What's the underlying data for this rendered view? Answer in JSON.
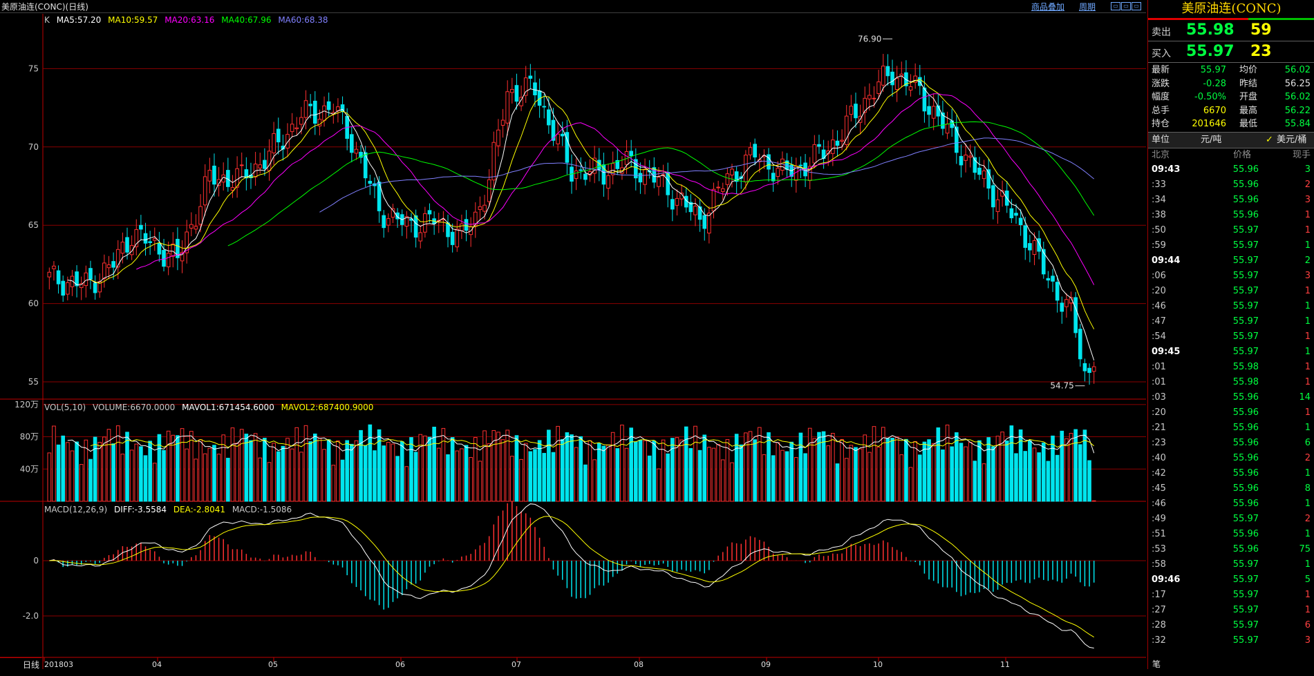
{
  "header": {
    "title": "美原油连(CONC)(日线)",
    "links": [
      "商品叠加",
      "周期"
    ]
  },
  "price_panel": {
    "legend_prefix": "K",
    "ma": [
      {
        "label": "MA5:57.20",
        "color": "#ffffff"
      },
      {
        "label": "MA10:59.57",
        "color": "#ffff00"
      },
      {
        "label": "MA20:63.16",
        "color": "#ff00ff"
      },
      {
        "label": "MA40:67.96",
        "color": "#00ff00"
      },
      {
        "label": "MA60:68.38",
        "color": "#8080ff"
      }
    ],
    "y_ticks": [
      "75",
      "70",
      "65",
      "60",
      "55"
    ],
    "y_values": [
      75,
      70,
      65,
      60,
      55
    ],
    "y_range": [
      53.9,
      78.5
    ],
    "high_label": "76.90",
    "high_value": 76.9,
    "low_label": "54.75",
    "low_value": 54.75
  },
  "volume_panel": {
    "legend": [
      {
        "label": "VOL(5,10)",
        "color": "#c8c8c8"
      },
      {
        "label": "VOLUME:6670.0000",
        "color": "#c8c8c8"
      },
      {
        "label": "MAVOL1:671454.6000",
        "color": "#ffffff"
      },
      {
        "label": "MAVOL2:687400.9000",
        "color": "#ffff00"
      }
    ],
    "y_ticks": [
      "120万",
      "80万",
      "40万"
    ],
    "y_values": [
      120,
      80,
      40
    ],
    "y_range": [
      0,
      125
    ]
  },
  "macd_panel": {
    "legend": [
      {
        "label": "MACD(12,26,9)",
        "color": "#c8c8c8"
      },
      {
        "label": "DIFF:-3.5584",
        "color": "#ffffff"
      },
      {
        "label": "DEA:-2.8041",
        "color": "#ffff00"
      },
      {
        "label": "MACD:-1.5086",
        "color": "#c8c8c8"
      }
    ],
    "y_ticks": [
      "0",
      "-2.0"
    ],
    "y_values": [
      0,
      -2
    ],
    "y_range": [
      -3.5,
      2.1
    ]
  },
  "x_axis": {
    "period_label": "日线",
    "labels": [
      "201803",
      "04",
      "05",
      "06",
      "07",
      "08",
      "09",
      "10",
      "11"
    ]
  },
  "quote": {
    "title": "美原油连(CONC)",
    "ask_label": "卖出",
    "ask_price": "55.98",
    "ask_vol": "59",
    "bid_label": "买入",
    "bid_price": "55.97",
    "bid_vol": "23",
    "stats": [
      {
        "label": "最新",
        "value": "55.97",
        "color": "#00ff40"
      },
      {
        "label": "均价",
        "value": "56.02",
        "color": "#00ff40"
      },
      {
        "label": "涨跌",
        "value": "-0.28",
        "color": "#00ff40"
      },
      {
        "label": "昨结",
        "value": "56.25",
        "color": "#e0e0e0"
      },
      {
        "label": "幅度",
        "value": "-0.50%",
        "color": "#00ff40"
      },
      {
        "label": "开盘",
        "value": "56.02",
        "color": "#00ff40"
      },
      {
        "label": "总手",
        "value": "6670",
        "color": "#ffff00"
      },
      {
        "label": "最高",
        "value": "56.22",
        "color": "#00ff40"
      },
      {
        "label": "持仓",
        "value": "201646",
        "color": "#ffff00"
      },
      {
        "label": "最低",
        "value": "55.84",
        "color": "#00ff40"
      }
    ],
    "unit_label": "单位",
    "unit_value": "元/吨",
    "unit_alt": "美元/桶",
    "col_time": "北京",
    "col_price": "价格",
    "col_vol": "现手",
    "bottom_label": "笔"
  },
  "ticks": [
    {
      "t": "09:43",
      "p": "55.96",
      "v": "3",
      "c": "#00ff40",
      "b": true
    },
    {
      "t": ":33",
      "p": "55.96",
      "v": "2",
      "c": "#ff4040",
      "b": false
    },
    {
      "t": ":34",
      "p": "55.96",
      "v": "3",
      "c": "#ff4040",
      "b": false
    },
    {
      "t": ":38",
      "p": "55.96",
      "v": "1",
      "c": "#ff4040",
      "b": false
    },
    {
      "t": ":50",
      "p": "55.97",
      "v": "1",
      "c": "#ff4040",
      "b": false
    },
    {
      "t": ":59",
      "p": "55.97",
      "v": "1",
      "c": "#00ff40",
      "b": false
    },
    {
      "t": "09:44",
      "p": "55.97",
      "v": "2",
      "c": "#00ff40",
      "b": true
    },
    {
      "t": ":06",
      "p": "55.97",
      "v": "3",
      "c": "#ff4040",
      "b": false
    },
    {
      "t": ":20",
      "p": "55.97",
      "v": "1",
      "c": "#ff4040",
      "b": false
    },
    {
      "t": ":46",
      "p": "55.97",
      "v": "1",
      "c": "#00ff40",
      "b": false
    },
    {
      "t": ":47",
      "p": "55.97",
      "v": "1",
      "c": "#00ff40",
      "b": false
    },
    {
      "t": ":54",
      "p": "55.97",
      "v": "1",
      "c": "#ff4040",
      "b": false
    },
    {
      "t": "09:45",
      "p": "55.97",
      "v": "1",
      "c": "#00ff40",
      "b": true
    },
    {
      "t": ":01",
      "p": "55.98",
      "v": "1",
      "c": "#ff4040",
      "b": false
    },
    {
      "t": ":01",
      "p": "55.98",
      "v": "1",
      "c": "#ff4040",
      "b": false
    },
    {
      "t": ":03",
      "p": "55.96",
      "v": "14",
      "c": "#00ff40",
      "b": false
    },
    {
      "t": ":20",
      "p": "55.96",
      "v": "1",
      "c": "#ff4040",
      "b": false
    },
    {
      "t": ":21",
      "p": "55.96",
      "v": "1",
      "c": "#00ff40",
      "b": false
    },
    {
      "t": ":23",
      "p": "55.96",
      "v": "6",
      "c": "#00ff40",
      "b": false
    },
    {
      "t": ":40",
      "p": "55.96",
      "v": "2",
      "c": "#ff4040",
      "b": false
    },
    {
      "t": ":42",
      "p": "55.96",
      "v": "1",
      "c": "#00ff40",
      "b": false
    },
    {
      "t": ":45",
      "p": "55.96",
      "v": "8",
      "c": "#00ff40",
      "b": false
    },
    {
      "t": ":46",
      "p": "55.96",
      "v": "1",
      "c": "#00ff40",
      "b": false
    },
    {
      "t": ":49",
      "p": "55.97",
      "v": "2",
      "c": "#ff4040",
      "b": false
    },
    {
      "t": ":51",
      "p": "55.96",
      "v": "1",
      "c": "#00ff40",
      "b": false
    },
    {
      "t": ":53",
      "p": "55.96",
      "v": "75",
      "c": "#00ff40",
      "b": false
    },
    {
      "t": ":58",
      "p": "55.97",
      "v": "1",
      "c": "#00ff40",
      "b": false
    },
    {
      "t": "09:46",
      "p": "55.97",
      "v": "5",
      "c": "#00ff40",
      "b": true
    },
    {
      "t": ":17",
      "p": "55.97",
      "v": "1",
      "c": "#ff4040",
      "b": false
    },
    {
      "t": ":27",
      "p": "55.97",
      "v": "1",
      "c": "#ff4040",
      "b": false
    },
    {
      "t": ":28",
      "p": "55.97",
      "v": "6",
      "c": "#ff4040",
      "b": false
    },
    {
      "t": ":32",
      "p": "55.97",
      "v": "3",
      "c": "#ff4040",
      "b": false
    }
  ],
  "colors": {
    "up": "#ff3030",
    "down": "#00e5ee",
    "grid": "#8b0000",
    "axis": "#c00000"
  }
}
